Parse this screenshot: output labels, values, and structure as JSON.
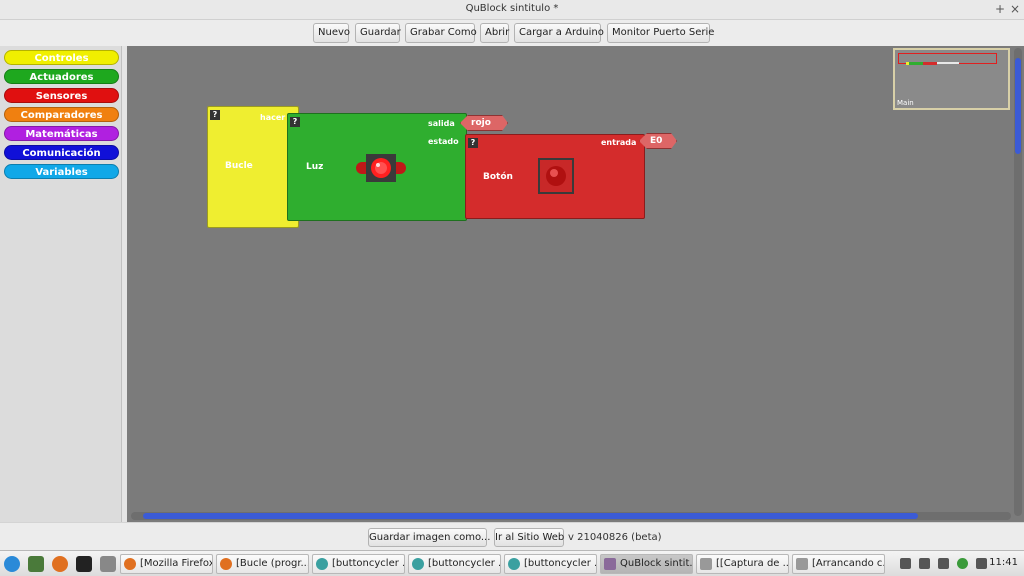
{
  "window": {
    "title": "QuBlock sintitulo *",
    "plus_glyph": "+",
    "close_glyph": "×"
  },
  "toolbar": {
    "new": "Nuevo",
    "save": "Guardar",
    "save_as": "Grabar Como",
    "open": "Abrir",
    "upload": "Cargar a Arduino",
    "serial_monitor": "Monitor Puerto Serie"
  },
  "palette": {
    "categories": [
      {
        "label": "Controles",
        "color": "#f0ef00"
      },
      {
        "label": "Actuadores",
        "color": "#1ea81e"
      },
      {
        "label": "Sensores",
        "color": "#e01010"
      },
      {
        "label": "Comparadores",
        "color": "#f08010"
      },
      {
        "label": "Matemáticas",
        "color": "#b020e0"
      },
      {
        "label": "Comunicación",
        "color": "#1010d8"
      },
      {
        "label": "Variables",
        "color": "#10a8e8"
      }
    ]
  },
  "workspace": {
    "minimap_label": "Main",
    "blocks": {
      "loop": {
        "help": "?",
        "title": "Bucle",
        "socket": "hacer",
        "color": "#efee30"
      },
      "light": {
        "help": "?",
        "title": "Luz",
        "socket_out": "salida",
        "socket_state": "estado",
        "color": "#2fae2f"
      },
      "button": {
        "help": "?",
        "title": "Botón",
        "socket_in": "entrada",
        "color": "#d42c2c"
      },
      "tag_color": {
        "label": "rojo"
      },
      "tag_pin": {
        "label": "E0"
      }
    }
  },
  "statusbar": {
    "save_image": "Guardar imagen como...",
    "website": "Ir al Sitio Web",
    "version": "v 21040826 (beta)"
  },
  "taskbar": {
    "tasks": [
      "[Mozilla Firefox]",
      "[Bucle (progr...",
      "[buttoncycler ...",
      "[buttoncycler ...",
      "[buttoncycler ...",
      "QuBlock sintit...",
      "[[Captura de ...",
      "[Arrancando c..."
    ],
    "clock": "11:41"
  }
}
